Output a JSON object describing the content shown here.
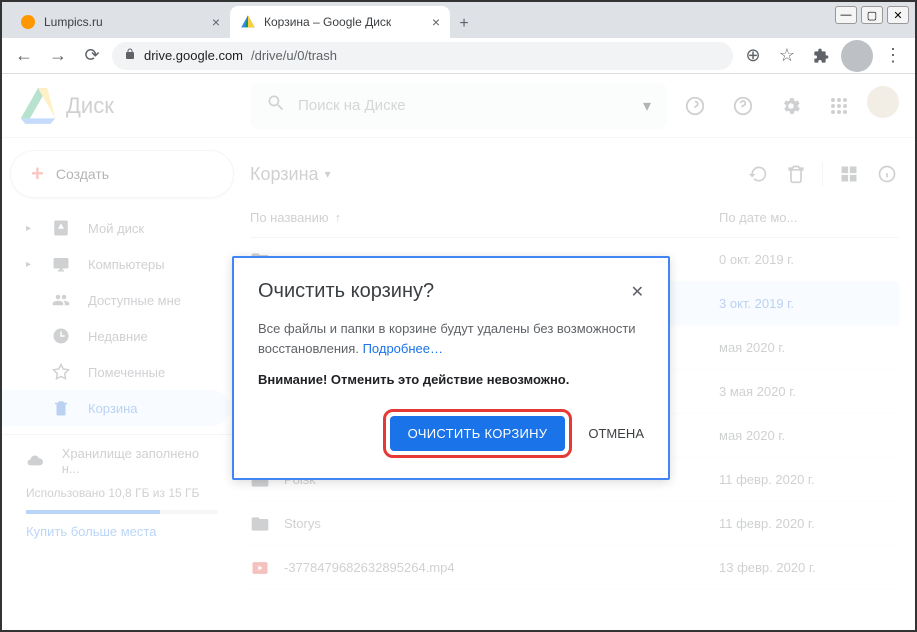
{
  "window": {
    "tabs": [
      {
        "title": "Lumpics.ru",
        "active": false
      },
      {
        "title": "Корзина – Google Диск",
        "active": true
      }
    ],
    "url_prefix": "drive.google.com",
    "url_path": "/drive/u/0/trash"
  },
  "app": {
    "logo_text": "Диск",
    "search_placeholder": "Поиск на Диске",
    "create_label": "Создать",
    "sidebar": [
      {
        "label": "Мой диск",
        "icon": "mydrive",
        "caret": true
      },
      {
        "label": "Компьютеры",
        "icon": "computers",
        "caret": true
      },
      {
        "label": "Доступные мне",
        "icon": "shared"
      },
      {
        "label": "Недавние",
        "icon": "recent"
      },
      {
        "label": "Помеченные",
        "icon": "starred"
      },
      {
        "label": "Корзина",
        "icon": "trash",
        "active": true
      }
    ],
    "storage": {
      "title": "Хранилище заполнено н...",
      "text": "Использовано 10,8 ГБ из 15 ГБ",
      "buy": "Купить больше места"
    },
    "breadcrumb": "Корзина",
    "columns": {
      "name": "По названию",
      "date": "По дате мо..."
    },
    "files": [
      {
        "name": "",
        "date": "0 окт. 2019 г.",
        "icon": "folder"
      },
      {
        "name": "",
        "date": "3 окт. 2019 г.",
        "icon": "folder",
        "selected": true
      },
      {
        "name": "",
        "date": " мая 2020 г.",
        "icon": "folder"
      },
      {
        "name": "",
        "date": "3 мая 2020 г.",
        "icon": "folder"
      },
      {
        "name": "",
        "date": " мая 2020 г.",
        "icon": "folder"
      },
      {
        "name": "Poisk",
        "date": "11 февр. 2020 г.",
        "icon": "folder"
      },
      {
        "name": "Storys",
        "date": "11 февр. 2020 г.",
        "icon": "folder"
      },
      {
        "name": "-3778479682632895264.mp4",
        "date": "13 февр. 2020 г.",
        "icon": "video"
      }
    ]
  },
  "modal": {
    "title": "Очистить корзину?",
    "body": "Все файлы и папки в корзине будут удалены без возможности восстановления.",
    "learn_more": "Подробнее…",
    "warning": "Внимание! Отменить это действие невозможно.",
    "confirm": "ОЧИСТИТЬ КОРЗИНУ",
    "cancel": "ОТМЕНА"
  }
}
